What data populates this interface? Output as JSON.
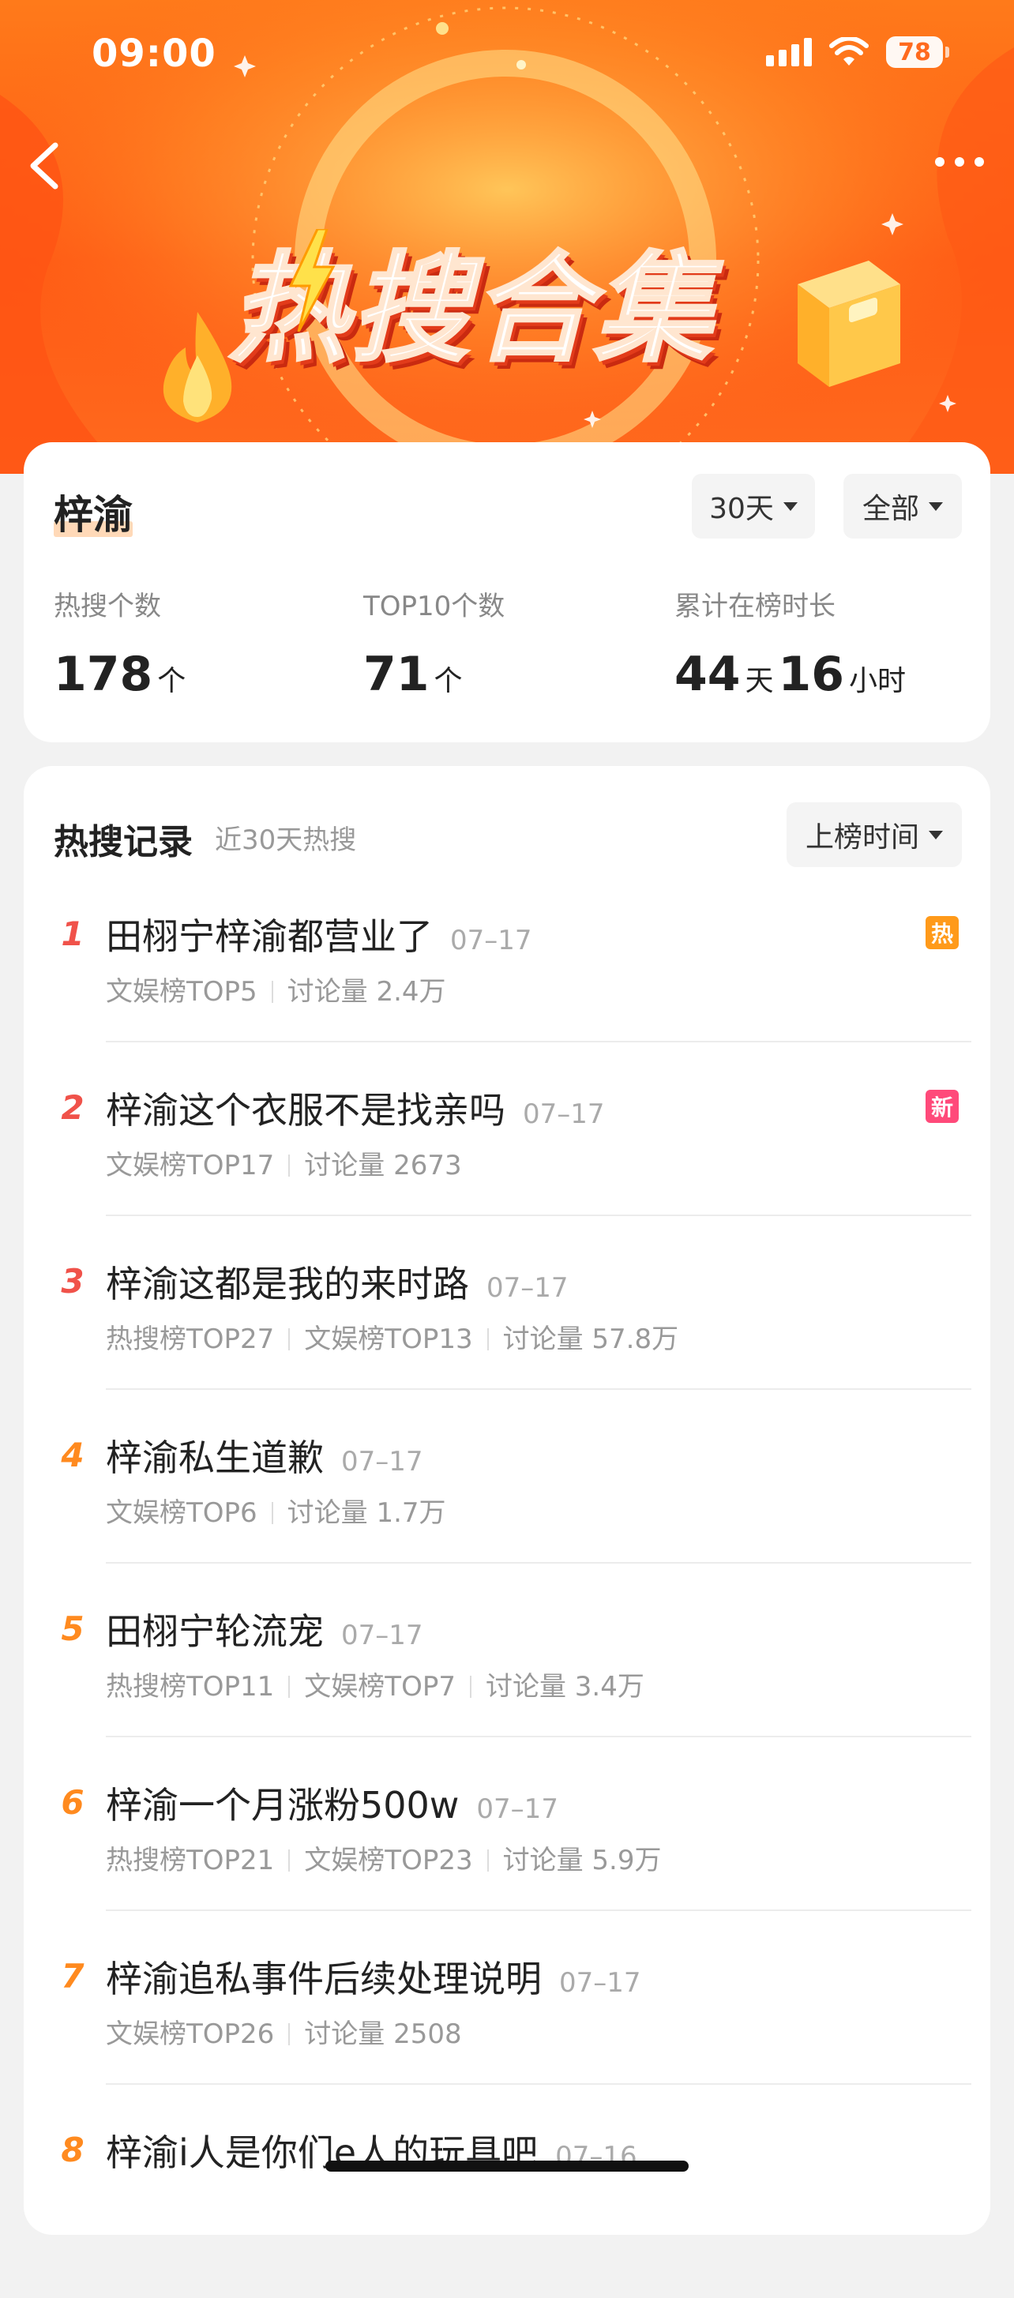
{
  "status_bar": {
    "time": "09:00",
    "battery": "78"
  },
  "banner": {
    "title": "热搜合集"
  },
  "profile": {
    "name": "梓渝",
    "filters": {
      "days": "30天",
      "scope": "全部"
    },
    "stats": [
      {
        "label": "热搜个数",
        "value": "178",
        "unit": "个"
      },
      {
        "label": "TOP10个数",
        "value": "71",
        "unit": "个"
      },
      {
        "label": "累计在榜时长",
        "value_days": "44",
        "unit_days": "天",
        "value_hours": "16",
        "unit_hours": "小时"
      }
    ]
  },
  "records": {
    "title": "热搜记录",
    "subtitle": "近30天热搜",
    "sort_label": "上榜时间",
    "items": [
      {
        "rank": "1",
        "title": "田栩宁梓渝都营业了",
        "date": "07–17",
        "meta": [
          "文娱榜TOP5",
          "讨论量 2.4万"
        ],
        "badge": "热"
      },
      {
        "rank": "2",
        "title": "梓渝这个衣服不是找亲吗",
        "date": "07–17",
        "meta": [
          "文娱榜TOP17",
          "讨论量 2673"
        ],
        "badge": "新"
      },
      {
        "rank": "3",
        "title": "梓渝这都是我的来时路",
        "date": "07–17",
        "meta": [
          "热搜榜TOP27",
          "文娱榜TOP13",
          "讨论量 57.8万"
        ]
      },
      {
        "rank": "4",
        "title": "梓渝私生道歉",
        "date": "07–17",
        "meta": [
          "文娱榜TOP6",
          "讨论量 1.7万"
        ]
      },
      {
        "rank": "5",
        "title": "田栩宁轮流宠",
        "date": "07–17",
        "meta": [
          "热搜榜TOP11",
          "文娱榜TOP7",
          "讨论量 3.4万"
        ]
      },
      {
        "rank": "6",
        "title": "梓渝一个月涨粉500w",
        "date": "07–17",
        "meta": [
          "热搜榜TOP21",
          "文娱榜TOP23",
          "讨论量 5.9万"
        ]
      },
      {
        "rank": "7",
        "title": "梓渝追私事件后续处理说明",
        "date": "07–17",
        "meta": [
          "文娱榜TOP26",
          "讨论量 2508"
        ]
      },
      {
        "rank": "8",
        "title": "梓渝i人是你们e人的玩具吧",
        "date": "07–16",
        "meta": []
      }
    ]
  },
  "colors": {
    "rank_top3": "#f0524a",
    "rank_rest": "#ff8a1f",
    "badge_hot": "#ff9a1a",
    "badge_new": "#ff4a7a",
    "banner": "#ff6a1e"
  }
}
